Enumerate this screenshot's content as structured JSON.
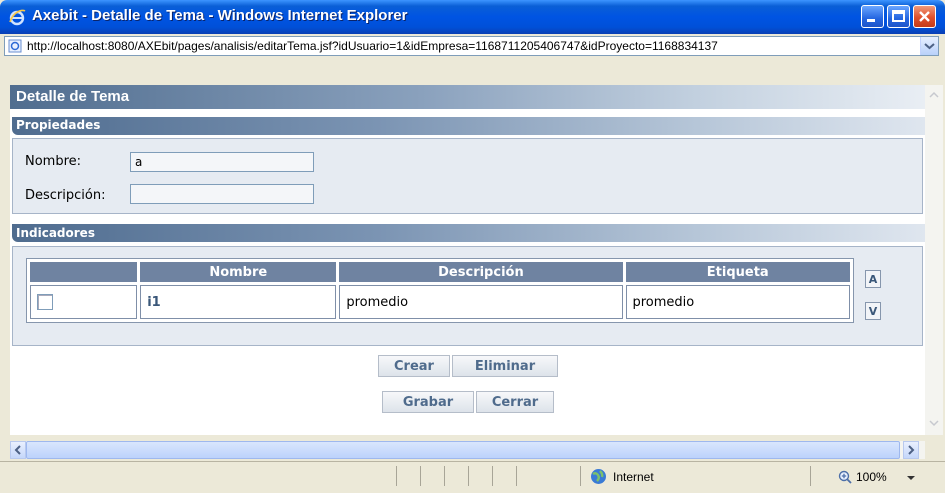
{
  "window": {
    "title": "Axebit - Detalle de Tema - Windows Internet Explorer",
    "url": "http://localhost:8080/AXEbit/pages/analisis/editarTema.jsf?idUsuario=1&idEmpresa=1168711205406747&idProyecto=1168834137"
  },
  "page": {
    "title": "Detalle de Tema",
    "properties": {
      "header": "Propiedades",
      "name_label": "Nombre:",
      "name_value": "a",
      "description_label": "Descripción:",
      "description_value": ""
    },
    "indicators": {
      "header": "Indicadores",
      "columns": [
        "",
        "Nombre",
        "Descripción",
        "Etiqueta"
      ],
      "rows": [
        {
          "name": "i1",
          "description": "promedio",
          "label": "promedio"
        }
      ],
      "side_buttons": [
        "A",
        "V"
      ]
    },
    "buttons": {
      "create": "Crear",
      "delete": "Eliminar",
      "save": "Grabar",
      "close": "Cerrar"
    }
  },
  "statusbar": {
    "zone": "Internet",
    "zoom": "100%"
  }
}
